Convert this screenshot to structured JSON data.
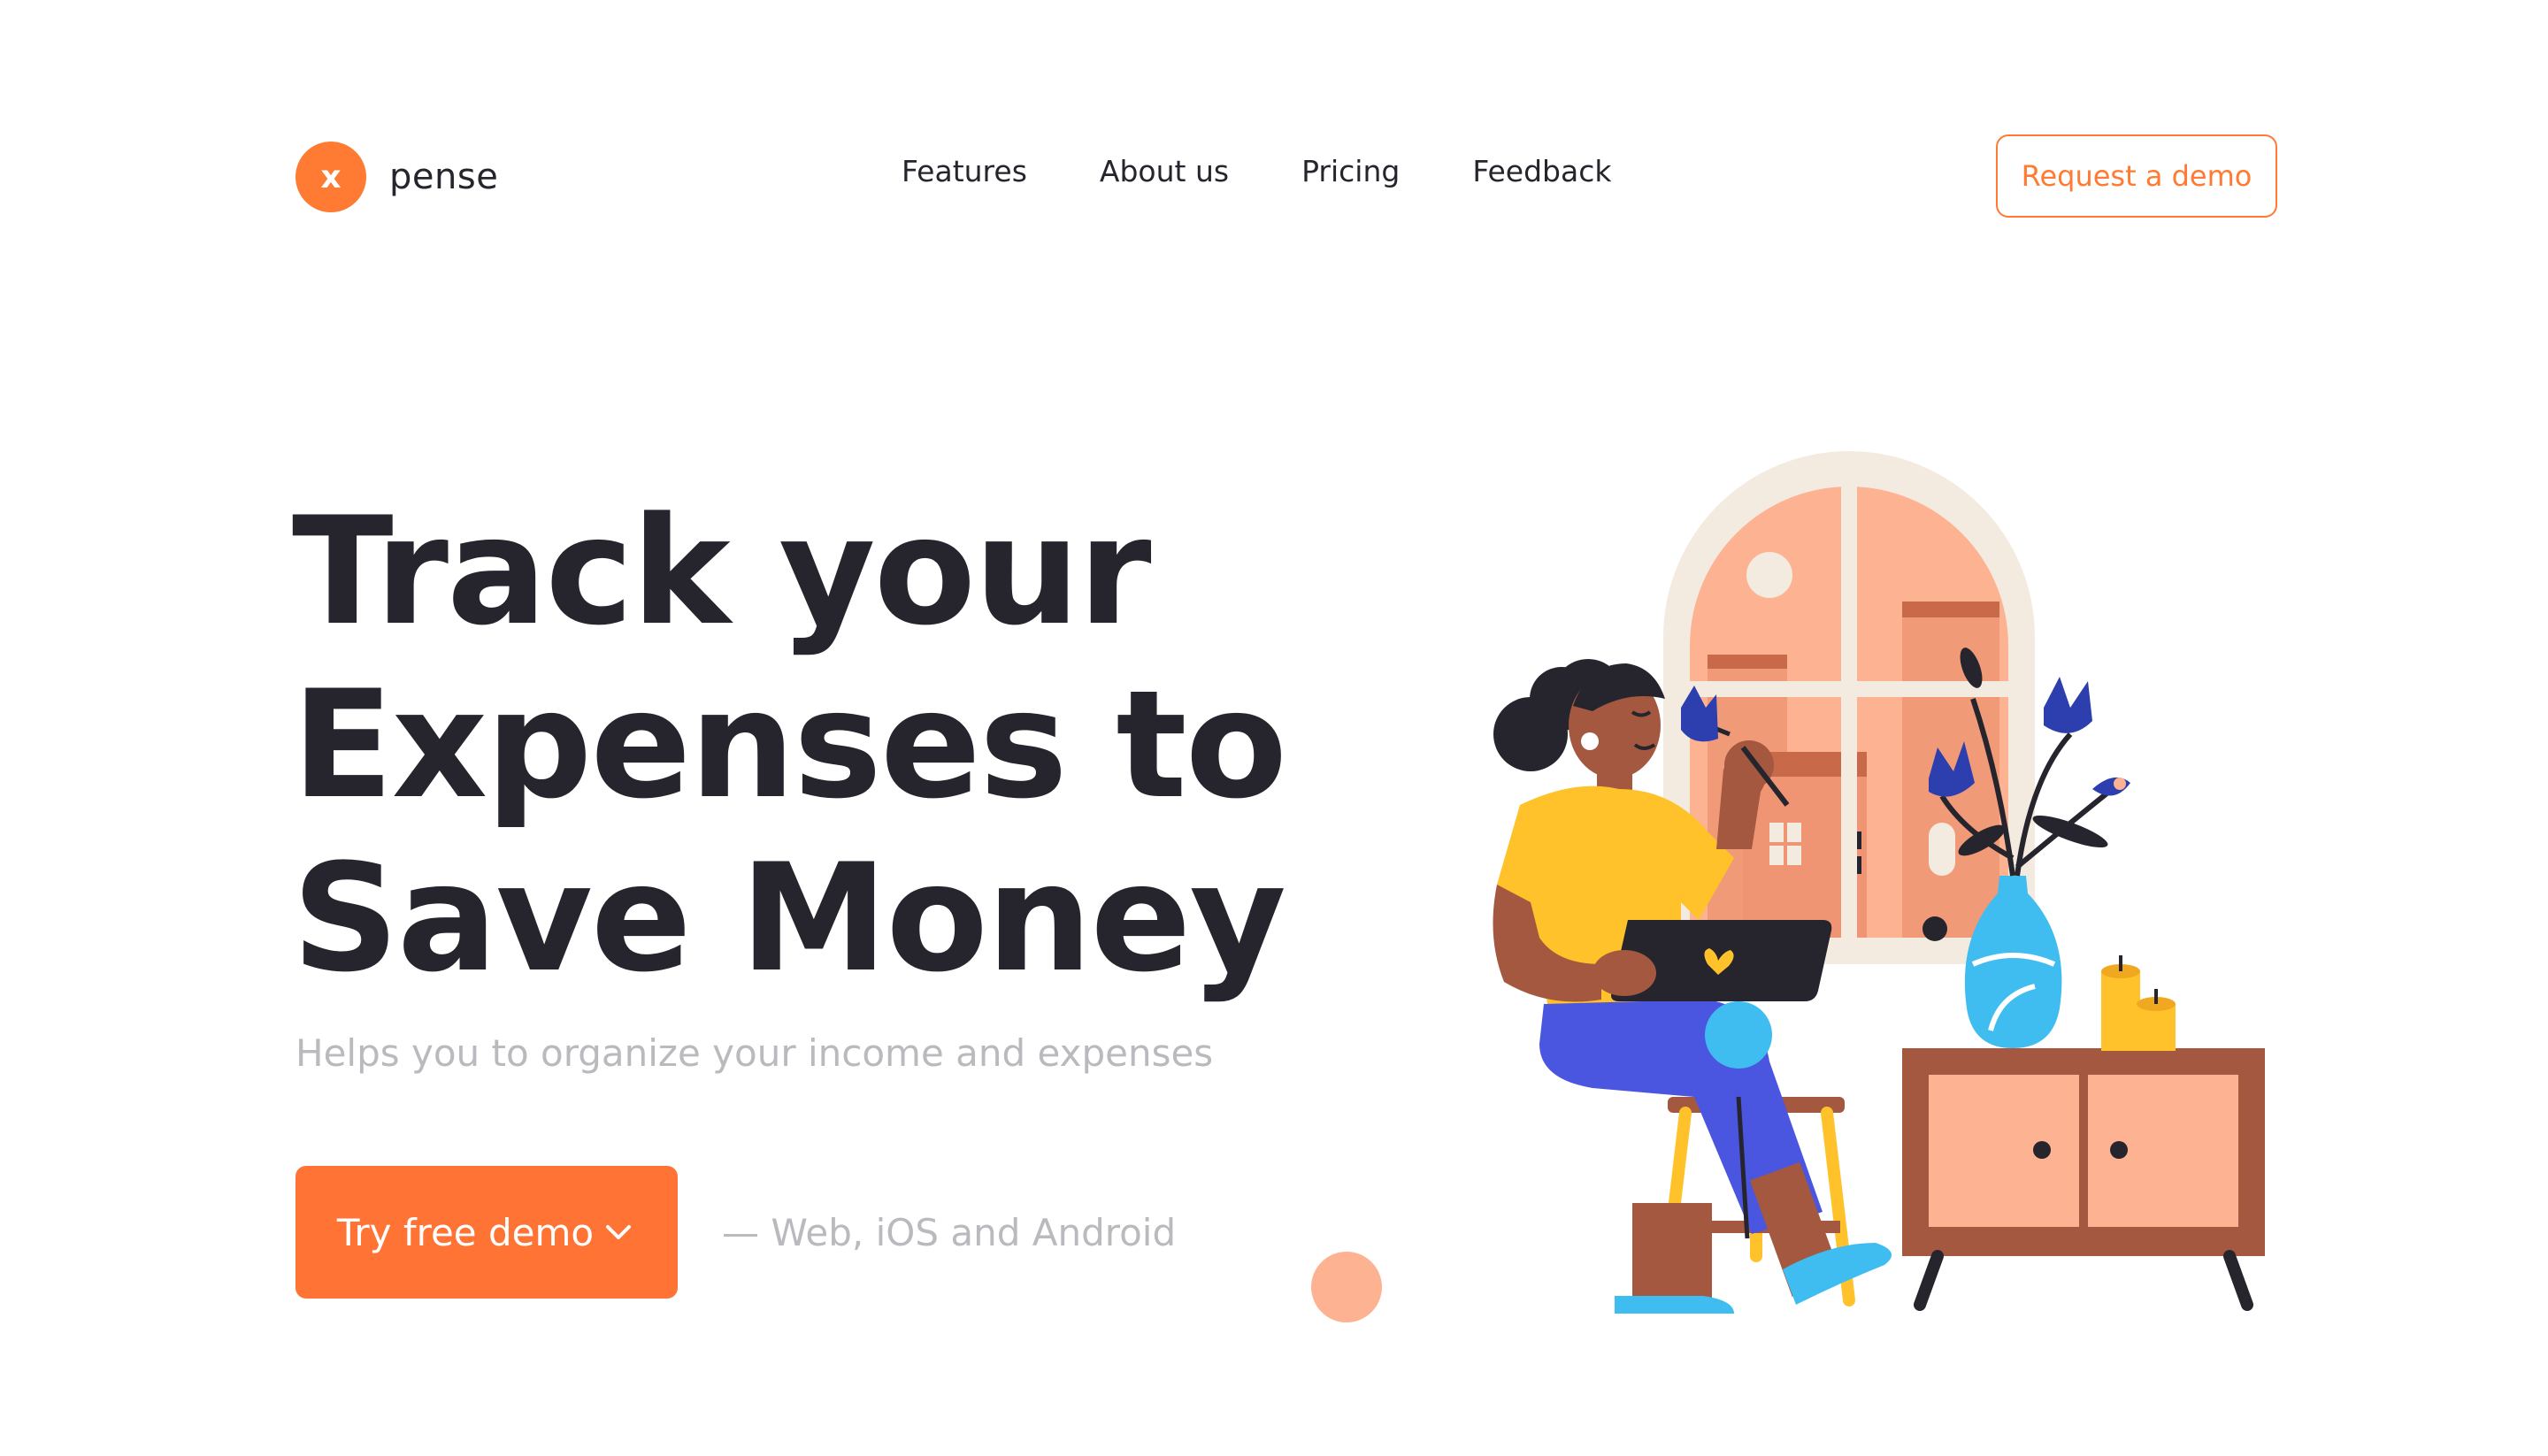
{
  "brand": {
    "mark": "x",
    "name": "pense",
    "accent": "#ff7a32"
  },
  "nav": {
    "items": [
      "Features",
      "About us",
      "Pricing",
      "Feedback"
    ],
    "request_label": "Request a demo"
  },
  "hero": {
    "title_lines": [
      "Track your",
      "Expenses to",
      "Save Money"
    ],
    "subtitle": "Helps you to organize your income and expenses",
    "cta_label": "Try free demo",
    "cta_icon": "chevron-down-icon",
    "platforms": "— Web, iOS and Android"
  },
  "colors": {
    "text": "#26252d",
    "muted": "#b9b9be",
    "accent": "#ff7a32",
    "window_frame": "#f4ebe0",
    "window_glass": "#fdb392",
    "cabinet": "#a4583f",
    "shirt": "#ffc22a",
    "pants": "#4a55e0",
    "vase": "#3fbdf0",
    "flowers": "#2d3fae"
  },
  "illustration": {
    "icon": "woman-with-laptop-illustration"
  }
}
